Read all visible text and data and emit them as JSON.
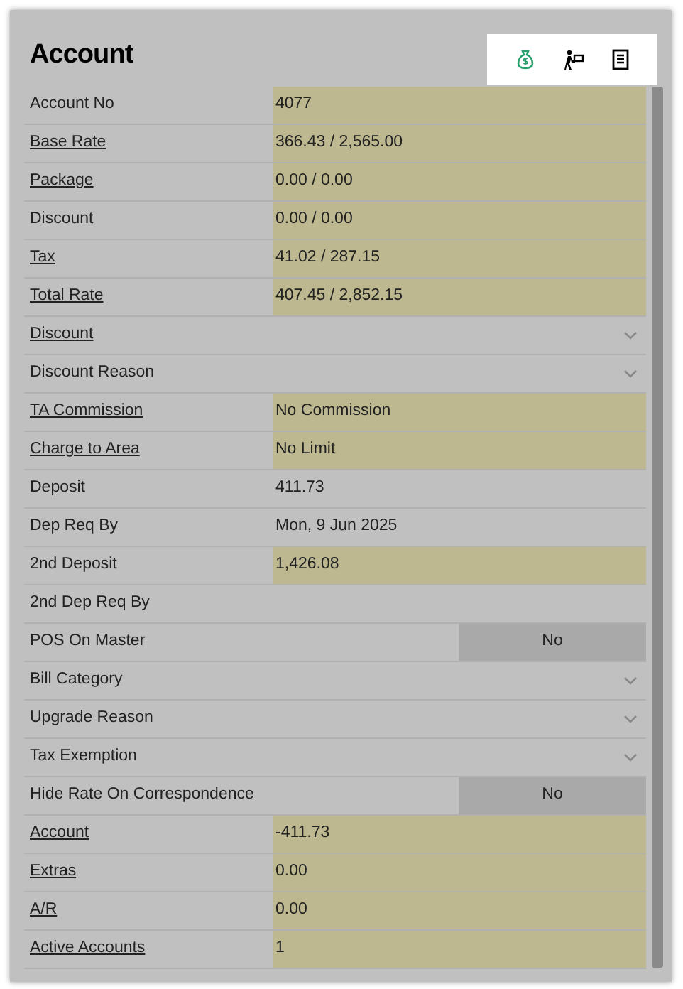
{
  "title": "Account",
  "rows": [
    {
      "kind": "value",
      "label": "Account No",
      "link": false,
      "value": "4077",
      "highlighted": true
    },
    {
      "kind": "value",
      "label": "Base Rate",
      "link": true,
      "value": "366.43 / 2,565.00",
      "highlighted": true
    },
    {
      "kind": "value",
      "label": "Package",
      "link": true,
      "value": "0.00 / 0.00",
      "highlighted": true
    },
    {
      "kind": "value",
      "label": "Discount",
      "link": false,
      "value": "0.00 / 0.00",
      "highlighted": true
    },
    {
      "kind": "value",
      "label": "Tax",
      "link": true,
      "value": "41.02 / 287.15",
      "highlighted": true
    },
    {
      "kind": "value",
      "label": "Total Rate",
      "link": true,
      "value": "407.45 / 2,852.15",
      "highlighted": true
    },
    {
      "kind": "dropdown",
      "label": "Discount",
      "link": true
    },
    {
      "kind": "dropdown",
      "label": "Discount Reason",
      "link": false
    },
    {
      "kind": "value",
      "label": "TA Commission",
      "link": true,
      "value": "No Commission",
      "highlighted": true
    },
    {
      "kind": "value",
      "label": "Charge to Area",
      "link": true,
      "value": "No Limit",
      "highlighted": true
    },
    {
      "kind": "value",
      "label": "Deposit",
      "link": false,
      "value": "411.73",
      "highlighted": false
    },
    {
      "kind": "value",
      "label": "Dep Req By",
      "link": false,
      "value": "Mon, 9 Jun 2025",
      "highlighted": false
    },
    {
      "kind": "value",
      "label": "2nd Deposit",
      "link": false,
      "value": "1,426.08",
      "highlighted": true
    },
    {
      "kind": "value",
      "label": "2nd Dep Req By",
      "link": false,
      "highlighted": false
    },
    {
      "kind": "toggle",
      "label": "POS On Master",
      "link": false,
      "value": "No"
    },
    {
      "kind": "dropdown",
      "label": "Bill Category",
      "link": false
    },
    {
      "kind": "dropdown",
      "label": "Upgrade Reason",
      "link": false
    },
    {
      "kind": "dropdown",
      "label": "Tax Exemption",
      "link": false
    },
    {
      "kind": "toggle",
      "label": "Hide Rate On Correspondence",
      "link": false,
      "value": "No"
    },
    {
      "kind": "value",
      "label": "Account",
      "link": true,
      "value": "-411.73",
      "highlighted": true
    },
    {
      "kind": "value",
      "label": "Extras",
      "link": true,
      "value": "0.00",
      "highlighted": true
    },
    {
      "kind": "value",
      "label": "A/R",
      "link": true,
      "value": "0.00",
      "highlighted": true
    },
    {
      "kind": "value",
      "label": "Active Accounts",
      "link": true,
      "value": "1",
      "highlighted": true
    }
  ]
}
